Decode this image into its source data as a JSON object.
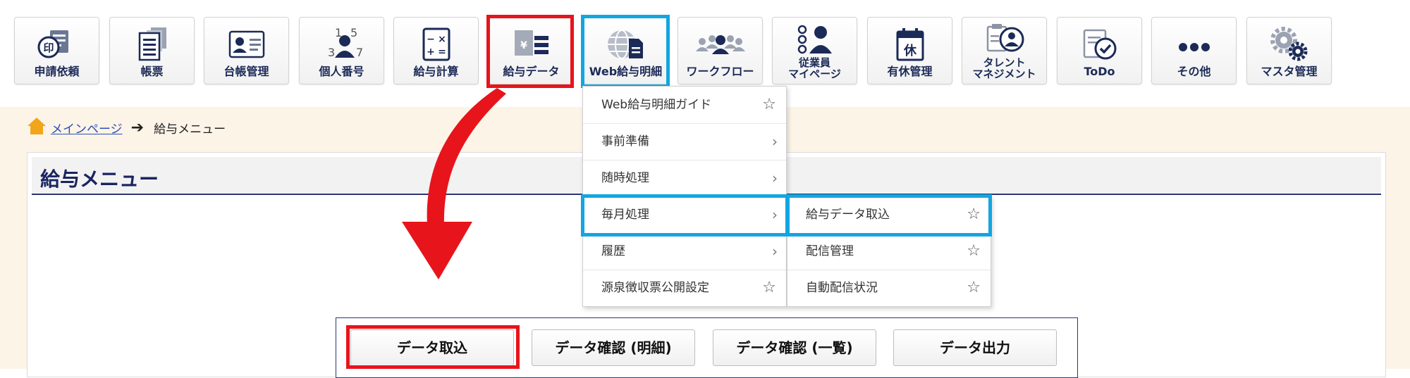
{
  "toolbar": {
    "items": [
      {
        "label": "申請依頼",
        "icon": "stamp-icon"
      },
      {
        "label": "帳票",
        "icon": "document-stack-icon"
      },
      {
        "label": "台帳管理",
        "icon": "id-card-icon"
      },
      {
        "label": "個人番号",
        "icon": "personal-number-icon"
      },
      {
        "label": "給与計算",
        "icon": "calculator-icon"
      },
      {
        "label": "給与データ",
        "icon": "payroll-data-icon"
      },
      {
        "label": "Web給与明細",
        "icon": "web-payslip-icon"
      },
      {
        "label": "ワークフロー",
        "icon": "workflow-icon"
      },
      {
        "label": "従業員",
        "label2": "マイページ",
        "icon": "employee-mypage-icon"
      },
      {
        "label": "有休管理",
        "icon": "calendar-leave-icon",
        "glyph": "休"
      },
      {
        "label": "タレント",
        "label2": "マネジメント",
        "icon": "talent-management-icon"
      },
      {
        "label": "ToDo",
        "icon": "todo-check-icon"
      },
      {
        "label": "その他",
        "icon": "more-dots-icon"
      },
      {
        "label": "マスタ管理",
        "icon": "gears-icon"
      }
    ]
  },
  "breadcrumb": {
    "home": "メインページ",
    "current": "給与メニュー"
  },
  "panel": {
    "title": "給与メニュー",
    "buttons": [
      "データ取込",
      "データ確認 (明細)",
      "データ確認 (一覧)",
      "データ出力"
    ]
  },
  "dropdown": {
    "items": [
      {
        "label": "Web給与明細ガイド",
        "star": "☆"
      },
      {
        "label": "事前準備",
        "chev": "›"
      },
      {
        "label": "随時処理",
        "chev": "›"
      },
      {
        "label": "毎月処理",
        "chev": "›"
      },
      {
        "label": "履歴",
        "chev": "›"
      },
      {
        "label": "源泉徴収票公開設定",
        "star": "☆"
      }
    ]
  },
  "submenu": {
    "items": [
      {
        "label": "給与データ取込",
        "star": "☆"
      },
      {
        "label": "配信管理",
        "star": "☆"
      },
      {
        "label": "自動配信状況",
        "star": "☆"
      }
    ]
  },
  "colors": {
    "highlight_red": "#e8141b",
    "highlight_blue": "#12a6e0",
    "navy": "#1b2a57"
  }
}
